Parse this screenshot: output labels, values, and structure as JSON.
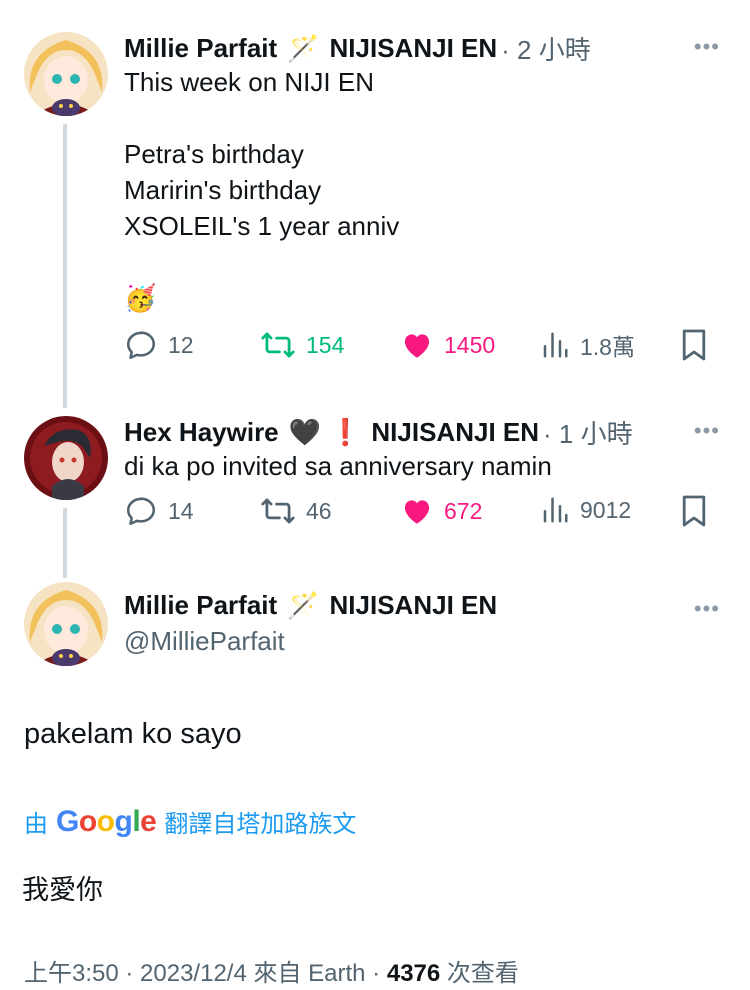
{
  "tweet1": {
    "author": "Millie Parfait",
    "emoji": "🪄",
    "org": "NIJISANJI EN",
    "time": "· 2 小時",
    "text": "This week on NIJI EN\n\nPetra's birthday\nMaririn's birthday\nXSOLEIL's 1 year anniv\n\n🥳",
    "more": "•••",
    "reply_count": "12",
    "retweet_count": "154",
    "like_count": "1450",
    "view_count": "1.8萬"
  },
  "tweet2": {
    "author": "Hex Haywire",
    "emoji1": "🖤",
    "emoji2": "❗",
    "org": "NIJISANJI EN",
    "time": "· 1 小時",
    "text": "di ka po invited sa anniversary namin",
    "more": "•••",
    "reply_count": "14",
    "retweet_count": "46",
    "like_count": "672",
    "view_count": "9012"
  },
  "main": {
    "author": "Millie Parfait",
    "emoji": "🪄",
    "org": "NIJISANJI EN",
    "handle": "@MillieParfait",
    "more": "•••",
    "text": "pakelam ko sayo",
    "translate_prefix": "由",
    "translate_suffix": "翻譯自塔加路族文",
    "translated_text": "我愛你",
    "footer_prefix": "上午3:50 · 2023/12/4 來自 Earth ·",
    "views_count": "4376",
    "views_label": "次查看"
  },
  "colors": {
    "retweet_active": "#00ba7c",
    "like_active": "#f91880",
    "link": "#1d9bf0",
    "muted": "#536471"
  }
}
